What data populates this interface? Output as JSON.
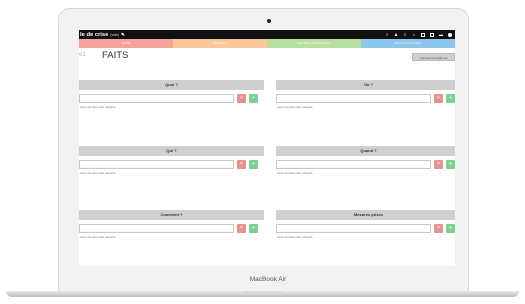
{
  "device": {
    "label": "MacBook Air"
  },
  "topbar": {
    "title": "le de crise",
    "subtitle": "(vide)"
  },
  "tabs": [
    {
      "label": "FAITS",
      "color": "#f4a39a",
      "active": true
    },
    {
      "label": "IMPACTS",
      "color": "#f8c79a",
      "active": false
    },
    {
      "label": "PARTIES PRENANTES",
      "color": "#b6dfa0",
      "active": false
    },
    {
      "label": "PLAN D'ACTIONS",
      "color": "#8ec6ea",
      "active": false
    }
  ],
  "header": {
    "eyebrow": "e1",
    "title": "FAITS",
    "button_label": "Comment remplir cet"
  },
  "panels": [
    {
      "title": "Quoi ?",
      "note": "Aucun fait dans cette catégorie"
    },
    {
      "title": "Où ?",
      "note": "Aucun fait dans cette catégorie"
    },
    {
      "title": "Qui ?",
      "note": "Aucun fait dans cette catégorie"
    },
    {
      "title": "Quand ?",
      "note": "Aucun fait dans cette catégorie"
    },
    {
      "title": "Comment ?",
      "note": "Aucun fait dans cette catégorie"
    },
    {
      "title": "Mesures prises",
      "note": "Aucun fait dans cette catégorie"
    }
  ],
  "icons": {
    "delete": "×",
    "add": "+"
  }
}
